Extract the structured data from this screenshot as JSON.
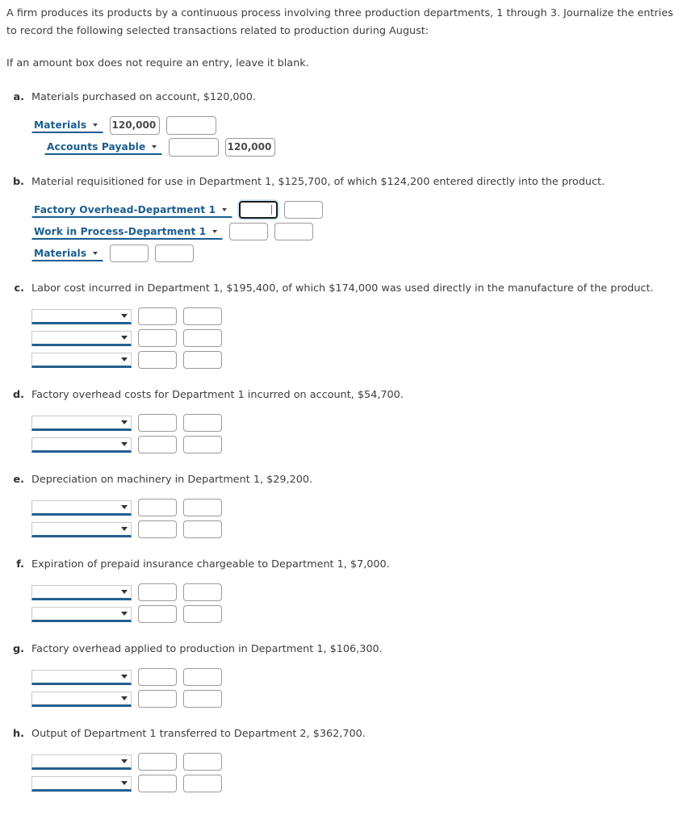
{
  "intro": {
    "paragraph_1": "A firm produces its products by a continuous process involving three production departments, 1 through 3. Journalize the entries to record the following selected transactions related to production during August:",
    "paragraph_2": "If an amount box does not require an entry, leave it blank."
  },
  "colors": {
    "account_text": "#1a5d8f",
    "select_underline": "#245f8f",
    "body_text": "#3d3d3d",
    "amount_border": "#9a9a9a",
    "focus_ring": "#cfe6f7",
    "caret": "#2f7fc4"
  },
  "icons": {
    "dropdown_caret": "chevron-down-icon"
  },
  "problems": [
    {
      "letter": "a.",
      "text": "Materials purchased on account, $120,000.",
      "box_style": "wide",
      "rows": [
        {
          "account": "Materials",
          "indent": 0,
          "debit": "120,000",
          "credit": "",
          "focused": false
        },
        {
          "account": "Accounts Payable",
          "indent": 1,
          "debit": "",
          "credit": "120,000",
          "focused": false
        }
      ]
    },
    {
      "letter": "b.",
      "text": "Material requisitioned for use in Department 1, $125,700, of which $124,200 entered directly into the product.",
      "box_style": "normal",
      "rows": [
        {
          "account": "Factory Overhead-Department 1",
          "indent": 0,
          "debit": "",
          "credit": "",
          "focused": true
        },
        {
          "account": "Work in Process-Department 1",
          "indent": 0,
          "debit": "",
          "credit": "",
          "focused": false
        },
        {
          "account": "Materials",
          "indent": 0,
          "debit": "",
          "credit": "",
          "focused": false
        }
      ]
    },
    {
      "letter": "c.",
      "text": "Labor cost incurred in Department 1, $195,400, of which $174,000 was used directly in the manufacture of the product.",
      "box_style": "normal",
      "rows": [
        {
          "account": "",
          "indent": 0,
          "debit": "",
          "credit": "",
          "focused": false
        },
        {
          "account": "",
          "indent": 0,
          "debit": "",
          "credit": "",
          "focused": false
        },
        {
          "account": "",
          "indent": 0,
          "debit": "",
          "credit": "",
          "focused": false
        }
      ]
    },
    {
      "letter": "d.",
      "text": "Factory overhead costs for Department 1 incurred on account, $54,700.",
      "box_style": "normal",
      "rows": [
        {
          "account": "",
          "indent": 0,
          "debit": "",
          "credit": "",
          "focused": false
        },
        {
          "account": "",
          "indent": 0,
          "debit": "",
          "credit": "",
          "focused": false
        }
      ]
    },
    {
      "letter": "e.",
      "text": "Depreciation on machinery in Department 1, $29,200.",
      "box_style": "normal",
      "rows": [
        {
          "account": "",
          "indent": 0,
          "debit": "",
          "credit": "",
          "focused": false
        },
        {
          "account": "",
          "indent": 0,
          "debit": "",
          "credit": "",
          "focused": false
        }
      ]
    },
    {
      "letter": "f.",
      "text": "Expiration of prepaid insurance chargeable to Department 1, $7,000.",
      "box_style": "normal",
      "rows": [
        {
          "account": "",
          "indent": 0,
          "debit": "",
          "credit": "",
          "focused": false
        },
        {
          "account": "",
          "indent": 0,
          "debit": "",
          "credit": "",
          "focused": false
        }
      ]
    },
    {
      "letter": "g.",
      "text": "Factory overhead applied to production in Department 1, $106,300.",
      "box_style": "normal",
      "rows": [
        {
          "account": "",
          "indent": 0,
          "debit": "",
          "credit": "",
          "focused": false
        },
        {
          "account": "",
          "indent": 0,
          "debit": "",
          "credit": "",
          "focused": false
        }
      ]
    },
    {
      "letter": "h.",
      "text": "Output of Department 1 transferred to Department 2, $362,700.",
      "box_style": "normal",
      "rows": [
        {
          "account": "",
          "indent": 0,
          "debit": "",
          "credit": "",
          "focused": false
        },
        {
          "account": "",
          "indent": 0,
          "debit": "",
          "credit": "",
          "focused": false
        }
      ]
    }
  ]
}
